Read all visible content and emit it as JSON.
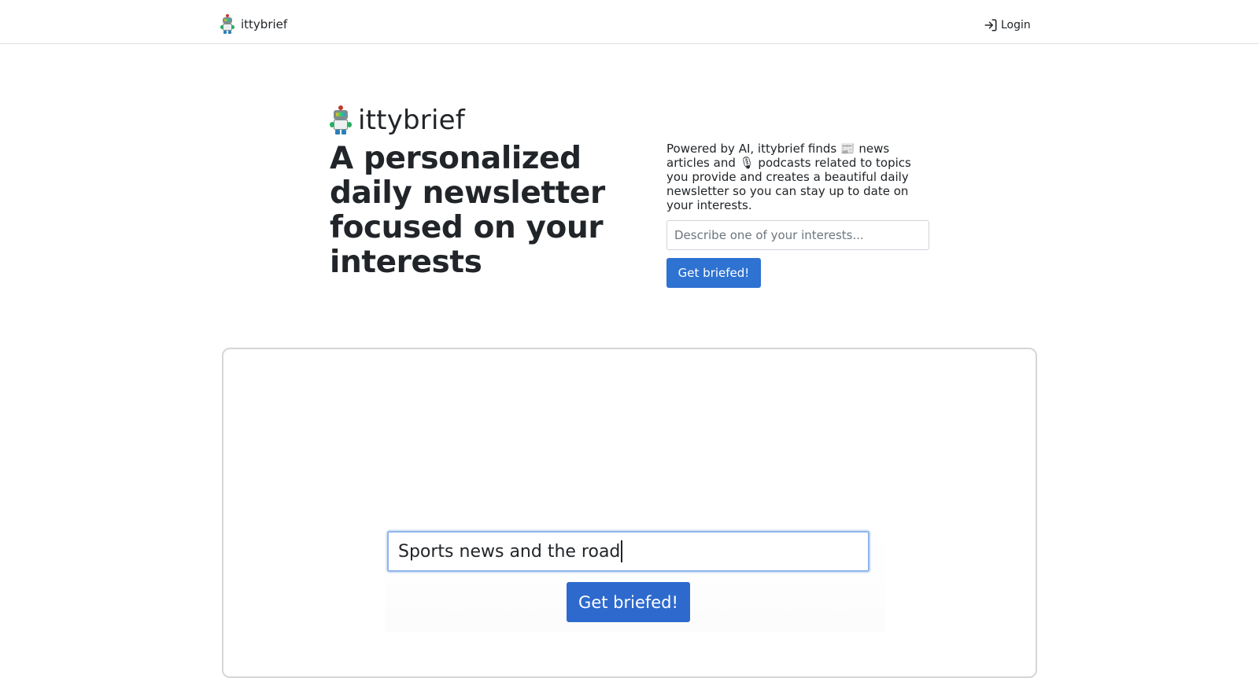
{
  "nav": {
    "brand": "ittybrief",
    "login_label": "Login"
  },
  "hero": {
    "brand": "ittybrief",
    "headline": "A personalized daily newsletter focused on your interests",
    "description": "Powered by AI, ittybrief finds 📰 news articles and 🎙 podcasts related to topics you provide and creates a beautiful daily newsletter so you can stay up to date on your interests.",
    "input_placeholder": "Describe one of your interests...",
    "cta_label": "Get briefed!"
  },
  "demo": {
    "input_value": "Sports news and the road",
    "button_label": "Get briefed!"
  },
  "colors": {
    "primary": "#2e72d2",
    "border": "#dee2e6",
    "text": "#212529"
  },
  "icons": {
    "logo": "robot-logo-icon",
    "login": "login-icon"
  }
}
